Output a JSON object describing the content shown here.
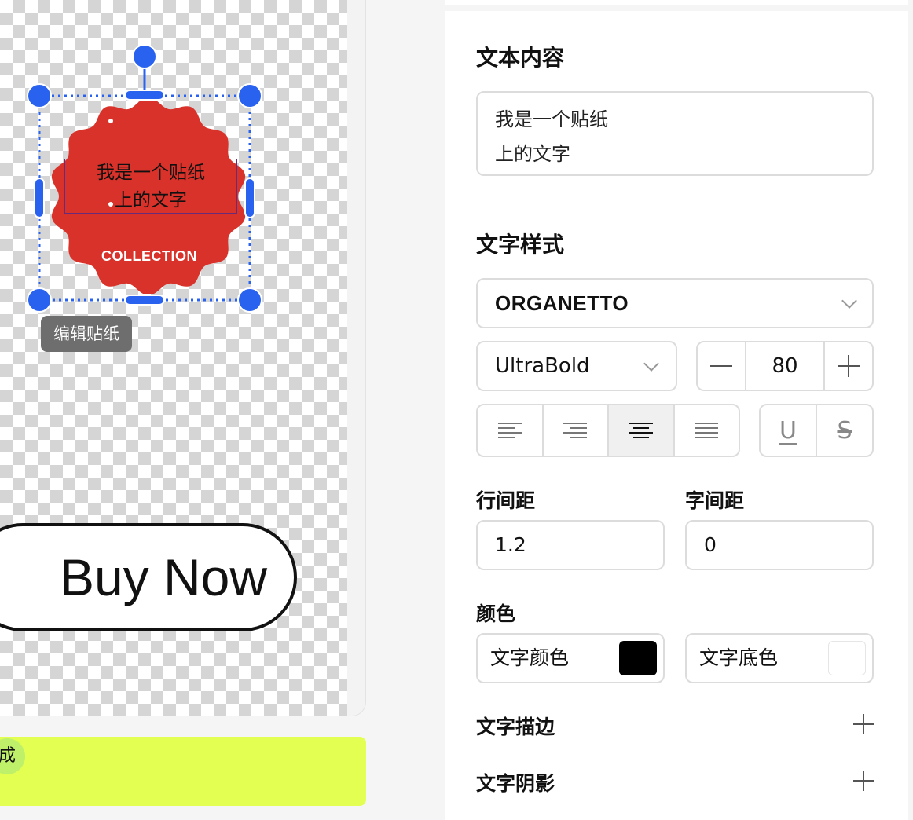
{
  "canvas": {
    "sticker": {
      "text_line1": "我是一个贴纸",
      "text_line2": "上的文字",
      "collection_label": "COLLECTION",
      "fill_color": "#d8322a",
      "accent_color": "#f5e25a"
    },
    "edit_tooltip": "编辑贴纸",
    "buy_button_label": "Buy Now",
    "selection_color": "#2a62f0"
  },
  "generate_bar": {
    "badge_text": "成",
    "color": "#e2ff52"
  },
  "panel": {
    "text_content": {
      "title": "文本内容",
      "value": "我是一个贴纸\n上的文字"
    },
    "text_style": {
      "title": "文字样式",
      "font_family": "ORGANETTO",
      "font_weight": "UltraBold",
      "font_size": "80",
      "alignment_options": [
        "left",
        "right",
        "center",
        "justify"
      ],
      "alignment_selected": "center"
    },
    "spacing": {
      "line_height_label": "行间距",
      "line_height_value": "1.2",
      "letter_spacing_label": "字间距",
      "letter_spacing_value": "0"
    },
    "color": {
      "title": "颜色",
      "text_color_label": "文字颜色",
      "text_color": "#000000",
      "background_color_label": "文字底色",
      "background_color": "#ffffff"
    },
    "stroke_label": "文字描边",
    "shadow_label": "文字阴影"
  }
}
